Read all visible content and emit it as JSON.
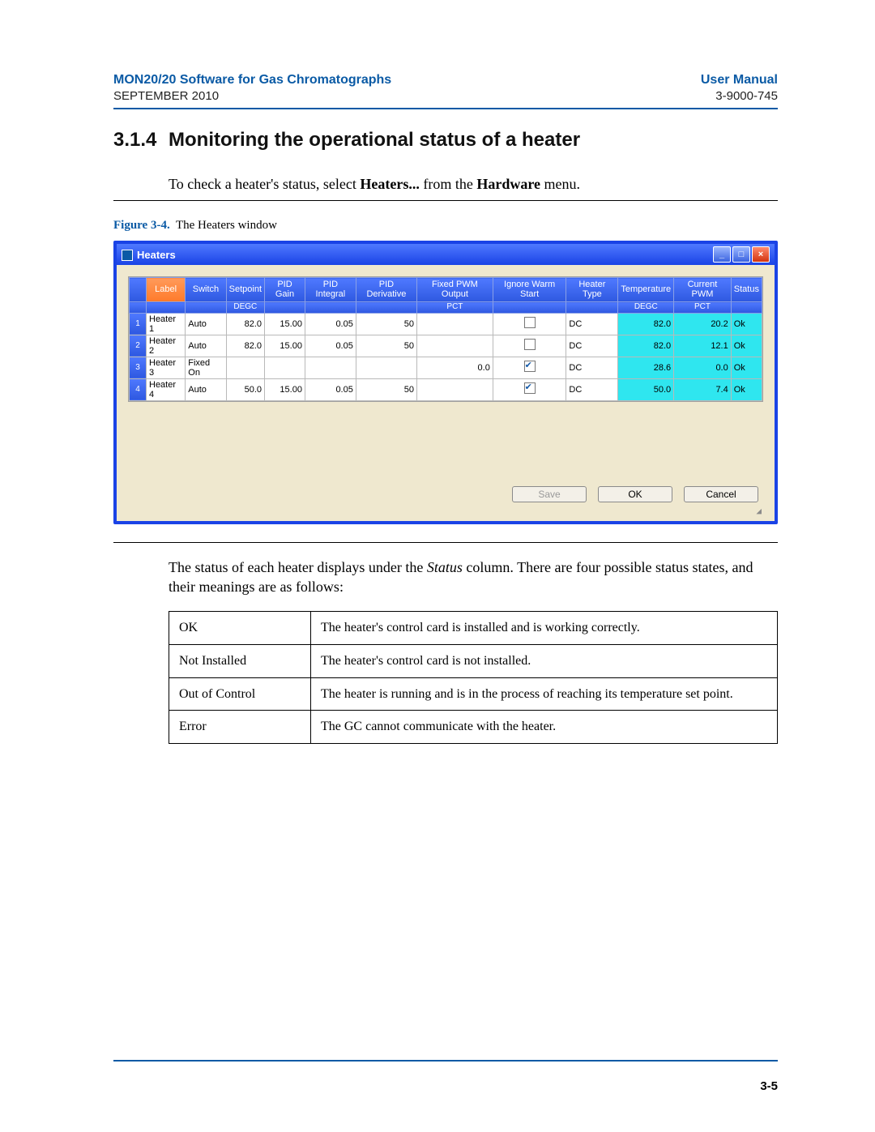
{
  "header": {
    "docTitle": "MON20/20 Software for Gas Chromatographs",
    "date": "SEPTEMBER 2010",
    "manual": "User Manual",
    "docNumber": "3-9000-745"
  },
  "section": {
    "number": "3.1.4",
    "title": "Monitoring the operational status of a heater"
  },
  "body": {
    "intro": {
      "pre": "To check a heater's status, select",
      "bold1": "Heaters...",
      "mid": "from the",
      "bold2": "Hardware",
      "post": "menu."
    },
    "statusPara": {
      "pre": "The status of each heater displays under the",
      "italic": "Status",
      "post": "column.  There are four possible status states, and their meanings are as follows:"
    }
  },
  "figure": {
    "label": "Figure 3-4.",
    "caption": "The Heaters window"
  },
  "window": {
    "title": "Heaters",
    "columns": [
      "Label",
      "Switch",
      "Setpoint",
      "PID Gain",
      "PID Integral",
      "PID Derivative",
      "Fixed PWM Output",
      "Ignore Warm Start",
      "Heater Type",
      "Temperature",
      "Current PWM",
      "Status"
    ],
    "units": {
      "setpoint": "DEGC",
      "fixedPwm": "PCT",
      "temperature": "DEGC",
      "currentPwm": "PCT"
    },
    "rows": [
      {
        "idx": "1",
        "label": "Heater 1",
        "switch": "Auto",
        "setpoint": "82.0",
        "pidGain": "15.00",
        "pidIntegral": "0.05",
        "pidDerivative": "50",
        "fixedPwm": "",
        "ignoreWarmStart": false,
        "heaterType": "DC",
        "temperature": "82.0",
        "currentPwm": "20.2",
        "status": "Ok"
      },
      {
        "idx": "2",
        "label": "Heater 2",
        "switch": "Auto",
        "setpoint": "82.0",
        "pidGain": "15.00",
        "pidIntegral": "0.05",
        "pidDerivative": "50",
        "fixedPwm": "",
        "ignoreWarmStart": false,
        "heaterType": "DC",
        "temperature": "82.0",
        "currentPwm": "12.1",
        "status": "Ok"
      },
      {
        "idx": "3",
        "label": "Heater 3",
        "switch": "Fixed On",
        "setpoint": "",
        "pidGain": "",
        "pidIntegral": "",
        "pidDerivative": "",
        "fixedPwm": "0.0",
        "ignoreWarmStart": true,
        "heaterType": "DC",
        "temperature": "28.6",
        "currentPwm": "0.0",
        "status": "Ok"
      },
      {
        "idx": "4",
        "label": "Heater 4",
        "switch": "Auto",
        "setpoint": "50.0",
        "pidGain": "15.00",
        "pidIntegral": "0.05",
        "pidDerivative": "50",
        "fixedPwm": "",
        "ignoreWarmStart": true,
        "heaterType": "DC",
        "temperature": "50.0",
        "currentPwm": "7.4",
        "status": "Ok"
      }
    ],
    "buttons": {
      "save": "Save",
      "ok": "OK",
      "cancel": "Cancel"
    }
  },
  "statusTable": [
    {
      "k": "OK",
      "v": "The heater's control card is installed and is working correctly."
    },
    {
      "k": "Not Installed",
      "v": "The heater's control card is not installed."
    },
    {
      "k": "Out of Control",
      "v": "The heater is running and is in the process of reaching its temperature set point."
    },
    {
      "k": "Error",
      "v": "The GC cannot communicate with the heater."
    }
  ],
  "footer": {
    "page": "3-5"
  }
}
